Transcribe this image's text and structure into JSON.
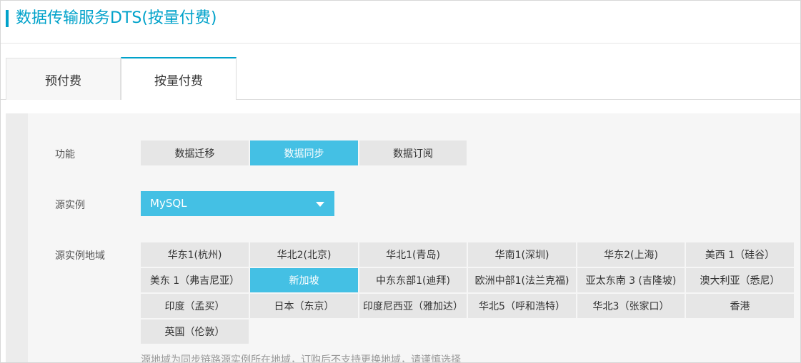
{
  "page": {
    "title": "数据传输服务DTS(按量付费)"
  },
  "tabs": [
    {
      "label": "预付费",
      "active": false
    },
    {
      "label": "按量付费",
      "active": true
    }
  ],
  "form": {
    "function": {
      "label": "功能",
      "options": [
        "数据迁移",
        "数据同步",
        "数据订阅"
      ],
      "selected": "数据同步"
    },
    "source_instance": {
      "label": "源实例",
      "value": "MySQL"
    },
    "source_region": {
      "label": "源实例地域",
      "options": [
        "华东1(杭州)",
        "华北2(北京)",
        "华北1(青岛)",
        "华南1(深圳)",
        "华东2(上海)",
        "美西 1（硅谷）",
        "美东 1（弗吉尼亚）",
        "新加坡",
        "中东东部1(迪拜)",
        "欧洲中部1(法兰克福)",
        "亚太东南 3 (吉隆坡)",
        "澳大利亚（悉尼）",
        "印度（孟买）",
        "日本（东京）",
        "印度尼西亚（雅加达）",
        "华北5（呼和浩特）",
        "华北3（张家口）",
        "香港",
        "英国（伦敦）"
      ],
      "selected": "新加坡",
      "note": "源地域为同步链路源实例所在地域，订购后不支持更换地域，请谨慎选择"
    }
  },
  "colors": {
    "accent": "#00a2ca",
    "selected_bg": "#44c0e4",
    "option_bg": "#e6e6e6",
    "panel_bg": "#f6f6f6"
  }
}
